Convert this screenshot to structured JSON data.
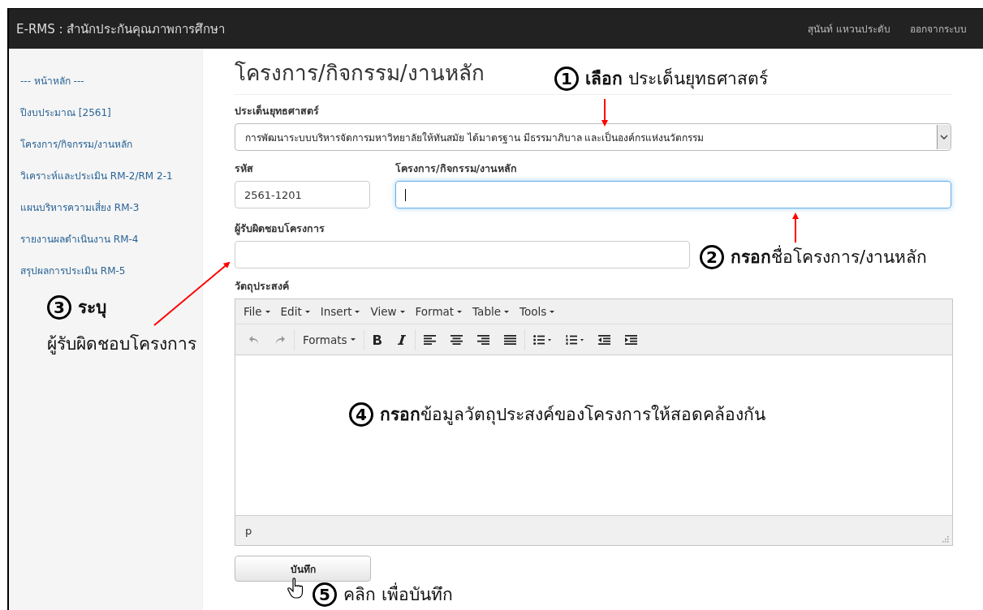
{
  "navbar": {
    "brand": "E-RMS : สำนักประกันคุณภาพการศึกษา",
    "user": "สุนันท์ แหวนประดับ",
    "logout": "ออกจากระบบ"
  },
  "sidebar": {
    "items": [
      {
        "label": "--- หน้าหลัก ---"
      },
      {
        "label": "ปีงบประมาณ [2561]"
      },
      {
        "label": "โครงการ/กิจกรรม/งานหลัก"
      },
      {
        "label": "วิเคราะห์และประเมิน RM-2/RM 2-1"
      },
      {
        "label": "แผนบริหารความเสี่ยง RM-3"
      },
      {
        "label": "รายงานผลดำเนินงาน RM-4"
      },
      {
        "label": "สรุปผลการประเมิน RM-5"
      }
    ]
  },
  "form": {
    "title": "โครงการ/กิจกรรม/งานหลัก",
    "strategy": {
      "label": "ประเด็นยุทธศาสตร์",
      "value": "การพัฒนาระบบบริหารจัดการมหาวิทยาลัยให้ทันสมัย ได้มาตรฐาน มีธรรมาภิบาล และเป็นองค์กรแห่งนวัตกรรม"
    },
    "code": {
      "label": "รหัส",
      "value": "2561-1201"
    },
    "project": {
      "label": "โครงการ/กิจกรรม/งานหลัก",
      "focused": true
    },
    "owner": {
      "label": "ผู้รับผิดชอบโครงการ"
    },
    "objective": {
      "label": "วัตถุประสงค์",
      "menus": [
        "File",
        "Edit",
        "Insert",
        "View",
        "Format",
        "Table",
        "Tools"
      ],
      "formats": "Formats",
      "status_path": "p"
    },
    "save_button": "บันทึก"
  },
  "annotations": [
    {
      "number": "1",
      "text": "**เลือก** ประเด็นยุทธศาสตร์"
    },
    {
      "number": "2",
      "text": "**กรอก**ชื่อโครงการ/งานหลัก"
    },
    {
      "number": "3",
      "text": "ระบุ",
      "text_2": "ผู้รับผิดชอบโครงการ"
    },
    {
      "number": "4",
      "text": "**กรอก**ข้อมูลวัตถุประสงค์ของโครงการให้สอดคล้องกัน"
    },
    {
      "number": "5",
      "text": "คลิก เพื่อบันทึก"
    }
  ]
}
